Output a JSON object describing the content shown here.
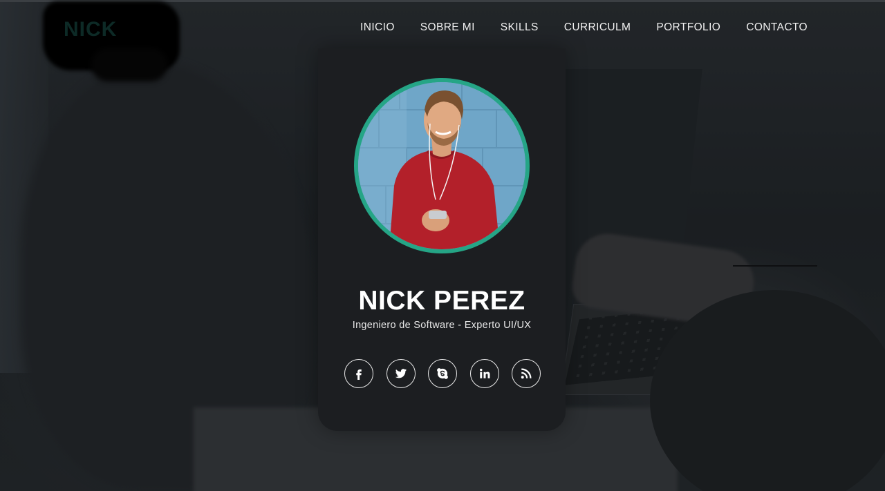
{
  "logo": {
    "text": "NICK"
  },
  "nav": {
    "items": [
      "INICIO",
      "SOBRE MI",
      "SKILLS",
      "CURRICULM",
      "PORTFOLIO",
      "CONTACTO"
    ]
  },
  "profile": {
    "name": "NICK PEREZ",
    "subtitle": "Ingeniero de Software - Experto UI/UX",
    "ring_color": "#25a586"
  },
  "social": {
    "icons": [
      "facebook-icon",
      "twitter-icon",
      "skype-icon",
      "linkedin-icon",
      "rss-icon"
    ]
  }
}
